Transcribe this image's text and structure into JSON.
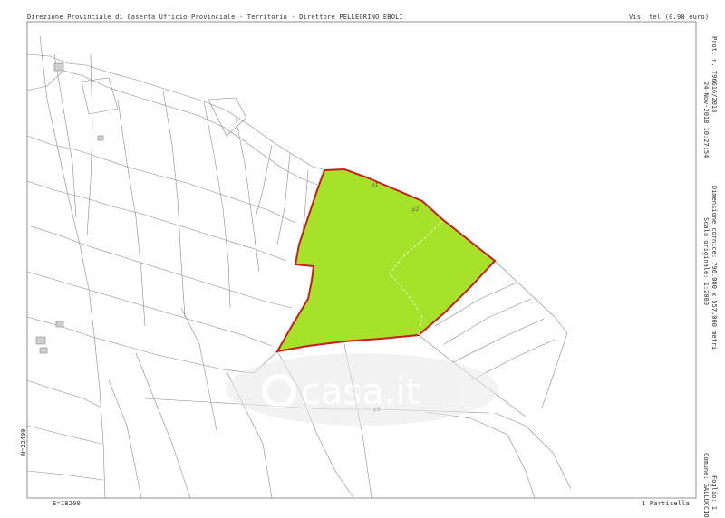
{
  "header": {
    "left": "Direzione Provinciale di Caserta  Ufficio Provinciale - Territorio - Direttore PELLEGRINO EBOLI",
    "right": "Vis. tel (0.90 euro)"
  },
  "side": {
    "date": "24-Nov-2018 10:27:54",
    "protocol": "Prot. n. T96616/2018",
    "scale": "Scala originale: 1:2000",
    "dimensions": "Dimensione cornice: 796.000 x 557.000 metri",
    "comune": "Comune: GALLUCCIO",
    "foglio": "Foglio: 1"
  },
  "footer": {
    "east": "E=18200",
    "north": "N=22400",
    "particella": "1 Particella"
  },
  "watermark": {
    "brand": "casa.it"
  },
  "parcel_labels": [
    "p1",
    "p2",
    "p3"
  ],
  "colors": {
    "highlight_fill": "#a6e22a",
    "highlight_stroke": "#cc1b1b",
    "lines": "#8a8a8a"
  }
}
